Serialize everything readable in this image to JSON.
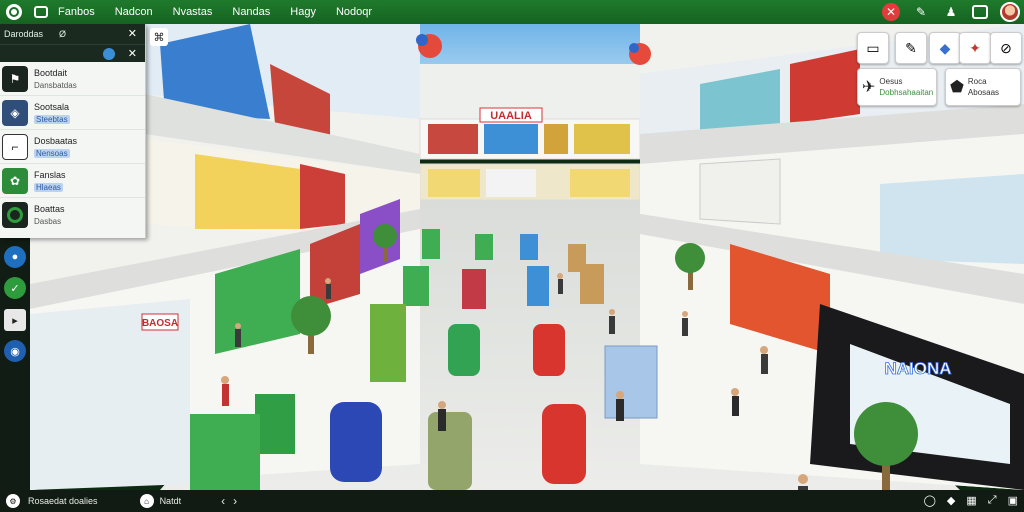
{
  "topbar": {
    "menu": [
      "Fanbos",
      "Nadcon",
      "Nvastas",
      "Nandas",
      "Hagy",
      "Nodoqr"
    ],
    "right_icons": [
      "no-entry-icon",
      "tools-icon",
      "user-add-icon",
      "image-icon",
      "avatar"
    ]
  },
  "panel": {
    "header_a": "Daroddas",
    "header_b": "Ø",
    "items": [
      {
        "title": "Bootdait",
        "sub": "Dansbatdas",
        "icon": "running-figure-icon",
        "badge": false
      },
      {
        "title": "Sootsala",
        "sub": "Steebtas",
        "icon": "sign-icon",
        "badge": true
      },
      {
        "title": "Dosbaatas",
        "sub": "Nensoas",
        "icon": "stairs-icon",
        "badge": true
      },
      {
        "title": "Fanslas",
        "sub": "Hlaeas",
        "icon": "leaf-icon",
        "badge": true
      },
      {
        "title": "Boattas",
        "sub": "Dasbas",
        "icon": "green-circle-icon",
        "badge": false
      }
    ]
  },
  "right_panel": {
    "card1_title": "Oesus",
    "card1_sub": "Dobhsahaaitan",
    "card2_title": "Roca",
    "card2_sub": "Abosaas"
  },
  "scene": {
    "storefront_center": "UAALIA",
    "storefront_left": "BAOSA",
    "storefront_right": "NAIONA"
  },
  "bottombar": {
    "left_text": "Rosaedat doalies",
    "mid_text": "Natdt"
  },
  "colors": {
    "topbar": "#1b6f2a",
    "accent_red": "#e23b3b",
    "accent_blue": "#3a8fd6"
  }
}
